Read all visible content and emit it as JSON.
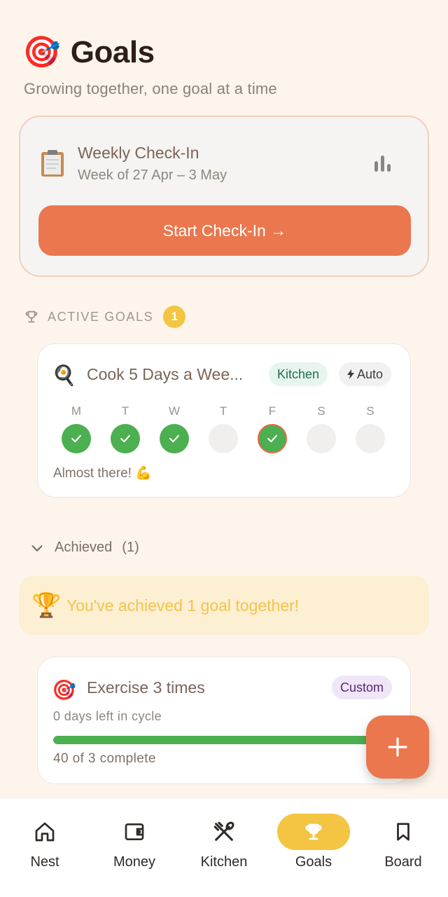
{
  "header": {
    "emoji": "🎯",
    "title": "Goals",
    "subtitle": "Growing together, one goal at a time"
  },
  "checkin": {
    "title": "Weekly Check-In",
    "week": "Week of 27 Apr – 3 May",
    "button_label": "Start Check-In →"
  },
  "active_section": {
    "label": "ACTIVE GOALS",
    "count": "1"
  },
  "active_goal": {
    "emoji": "🍳",
    "title": "Cook 5 Days a Wee...",
    "tags": [
      "Kitchen",
      "Auto"
    ],
    "days": [
      {
        "letter": "M",
        "done": true
      },
      {
        "letter": "T",
        "done": true
      },
      {
        "letter": "W",
        "done": true
      },
      {
        "letter": "T",
        "done": false
      },
      {
        "letter": "F",
        "done": true,
        "today": true
      },
      {
        "letter": "S",
        "done": false
      },
      {
        "letter": "S",
        "done": false
      }
    ],
    "status": "Almost there! 💪"
  },
  "achieved": {
    "label": "Achieved",
    "count": "(1)",
    "banner_emoji": "🏆",
    "banner_text": "You've achieved 1 goal together!"
  },
  "achieved_goal": {
    "emoji": "🎯",
    "title": "Exercise 3 times",
    "tag": "Custom",
    "days_left": "0 days left in cycle",
    "progress": 1.0,
    "complete_text": "40 of 3 complete"
  },
  "fab": {
    "icon": "plus-icon"
  },
  "nav": {
    "items": [
      {
        "label": "Nest",
        "icon": "home-icon"
      },
      {
        "label": "Money",
        "icon": "wallet-icon"
      },
      {
        "label": "Kitchen",
        "icon": "utensils-icon"
      },
      {
        "label": "Goals",
        "icon": "trophy-icon",
        "active": true
      },
      {
        "label": "Board",
        "icon": "bookmark-icon"
      }
    ]
  },
  "colors": {
    "accent": "#ea774e",
    "gold": "#f4c542",
    "green": "#4caf50",
    "background": "#fdf5ec"
  }
}
